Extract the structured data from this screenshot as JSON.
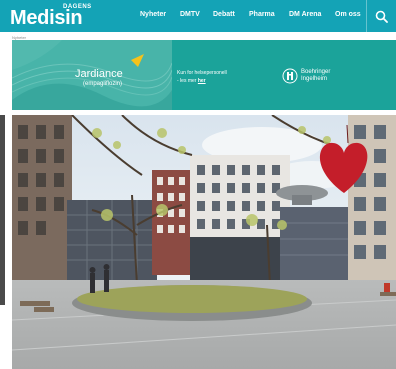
{
  "header": {
    "logo_top": "DAGENS",
    "logo_main": "Medisin",
    "nav": [
      "Nyheter",
      "DMTV",
      "Debatt",
      "Pharma",
      "DM Arena",
      "Om oss"
    ],
    "colors": {
      "header_bg": "#14a3b6",
      "ad_bg": "#1ba39a"
    }
  },
  "breadcrumb": "Nyheter",
  "ad": {
    "brand": "Jardiance",
    "brand_sub": "(empagliflozin)",
    "text_line1": "Kun for helsepersonell",
    "text_line2_prefix": "- les mer ",
    "text_link": "her",
    "company_line1": "Boehringer",
    "company_line2": "Ingelheim"
  },
  "icons": {
    "search": "search-icon",
    "bi": "boehringer-logo-icon"
  }
}
